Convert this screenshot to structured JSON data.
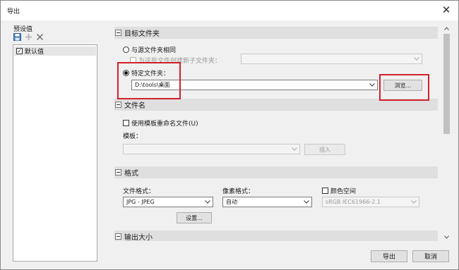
{
  "window": {
    "title": "导出"
  },
  "presets": {
    "label": "预设值",
    "items": [
      {
        "label": "默认值",
        "checked": true
      }
    ]
  },
  "target_folder": {
    "title": "目标文件夹",
    "same_as_source_label": "与源文件夹相同",
    "subfolder_label": "为这些文件创建新子文件夹：",
    "specific_folder_label": "特定文件夹：",
    "path_value": "D:\\tools\\桌面",
    "browse_label": "浏览..."
  },
  "file_name": {
    "title": "文件名",
    "use_template_label": "使用模板重命名文件(U)",
    "template_label": "模板：",
    "template_value": "",
    "insert_label": "插入"
  },
  "format": {
    "title": "格式",
    "file_format_label": "文件格式：",
    "file_format_value": "JPG - JPEG",
    "pixel_format_label": "像素格式：",
    "pixel_format_value": "自动",
    "color_space_label": "颜色空间",
    "color_space_value": "sRGB IEC61966-2.1",
    "settings_label": "设置..."
  },
  "output_size": {
    "title": "输出大小"
  },
  "footer": {
    "export_label": "导出",
    "cancel_label": "取消"
  },
  "colors": {
    "highlight": "#d4202a"
  }
}
